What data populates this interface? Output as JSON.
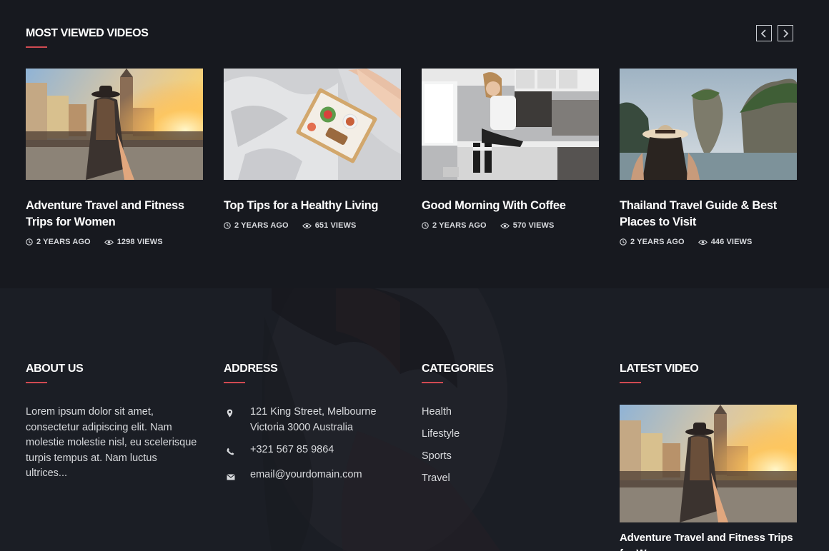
{
  "most_viewed": {
    "title": "MOST VIEWED VIDEOS",
    "accent_color": "#d14a52",
    "nav": {
      "prev_icon": "chevron-left-icon",
      "next_icon": "chevron-right-icon"
    },
    "videos": [
      {
        "title": "Adventure Travel and Fitness Trips for Women",
        "age": "2 YEARS AGO",
        "views": "1298 VIEWS"
      },
      {
        "title": "Top Tips for a Healthy Living",
        "age": "2 YEARS AGO",
        "views": "651 VIEWS"
      },
      {
        "title": "Good Morning With Coffee",
        "age": "2 YEARS AGO",
        "views": "570 VIEWS"
      },
      {
        "title": "Thailand Travel Guide & Best Places to Visit",
        "age": "2 YEARS AGO",
        "views": "446 VIEWS"
      }
    ]
  },
  "footer": {
    "about": {
      "title": "ABOUT US",
      "text": "Lorem ipsum dolor sit amet, consectetur adipiscing elit. Nam molestie molestie nisl, eu scelerisque turpis tempus at. Nam luctus ultrices..."
    },
    "address": {
      "title": "ADDRESS",
      "street": "121 King Street, Melbourne Victoria 3000 Australia",
      "phone": "+321 567 85 9864",
      "email": "email@yourdomain.com"
    },
    "categories": {
      "title": "CATEGORIES",
      "items": [
        "Health",
        "Lifestyle",
        "Sports",
        "Travel"
      ]
    },
    "latest_video": {
      "title": "LATEST VIDEO",
      "video_title": "Adventure Travel and Fitness Trips for Women"
    }
  }
}
